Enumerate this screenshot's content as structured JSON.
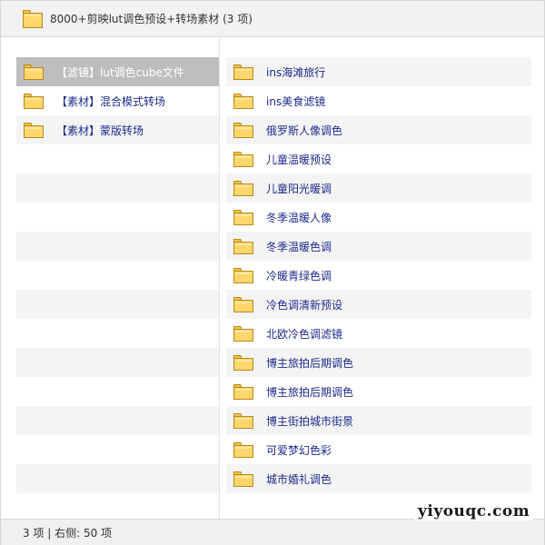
{
  "window": {
    "title": "8000+剪映lut调色预设+转场素材 (3 项)"
  },
  "left_pane": {
    "items": [
      {
        "label": "【滤镜】lut调色cube文件",
        "selected": true
      },
      {
        "label": "【素材】混合模式转场",
        "selected": false
      },
      {
        "label": "【素材】蒙版转场",
        "selected": false
      }
    ]
  },
  "right_pane": {
    "items": [
      {
        "label": "ins海滩旅行"
      },
      {
        "label": "ins美食滤镜"
      },
      {
        "label": "俄罗斯人像调色"
      },
      {
        "label": "儿童温暖预设"
      },
      {
        "label": "儿童阳光暖调"
      },
      {
        "label": "冬季温暖人像"
      },
      {
        "label": "冬季温暖色调"
      },
      {
        "label": "冷暖青绿色调"
      },
      {
        "label": "冷色调清新预设"
      },
      {
        "label": "北欧冷色调滤镜"
      },
      {
        "label": "博主旅拍后期调色"
      },
      {
        "label": "博主旅拍后期调色"
      },
      {
        "label": "博主街拍城市街景"
      },
      {
        "label": "可爱梦幻色彩"
      },
      {
        "label": "城市婚礼调色"
      }
    ]
  },
  "statusbar": {
    "text": "3 项 | 右侧: 50 项"
  },
  "watermark": {
    "text": "yiyouqc.com"
  },
  "icons": {
    "folder": "folder-icon"
  },
  "colors": {
    "folder_fill": "#ffd66b",
    "folder_border": "#b88a1c",
    "link_text": "#1f2a8a",
    "selected_row": "#bdbdbd"
  }
}
